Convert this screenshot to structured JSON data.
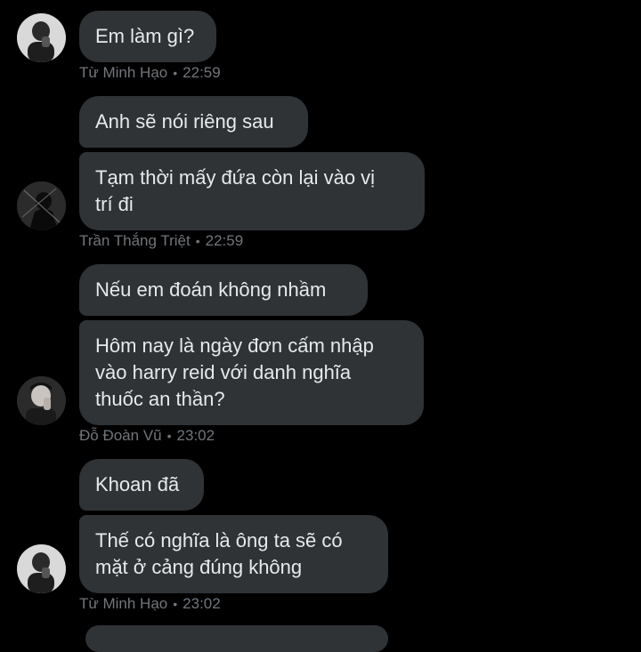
{
  "messages": [
    {
      "sender": "Từ Minh Hạo",
      "time": "22:59",
      "bubbles": [
        "Em làm gì?"
      ]
    },
    {
      "sender": "Trần Thắng Triệt",
      "time": "22:59",
      "bubbles": [
        "Anh sẽ nói riêng sau",
        "Tạm thời mấy đứa còn lại vào vị\ntrí đi"
      ]
    },
    {
      "sender": "Đỗ Đoàn Vũ",
      "time": "23:02",
      "bubbles": [
        "Nếu em đoán không nhầm",
        "Hôm nay là ngày đơn cấm nhập\nvào harry reid với danh nghĩa\nthuốc an thần?"
      ]
    },
    {
      "sender": "Từ Minh Hạo",
      "time": "23:02",
      "bubbles": [
        "Khoan đã",
        "Thế có nghĩa là ông ta sẽ có\nmặt ở cảng đúng không"
      ]
    }
  ],
  "separator": "•",
  "colors": {
    "background": "#000000",
    "bubble": "#2f3336",
    "text": "#e7e9ea",
    "meta": "#71767b"
  }
}
